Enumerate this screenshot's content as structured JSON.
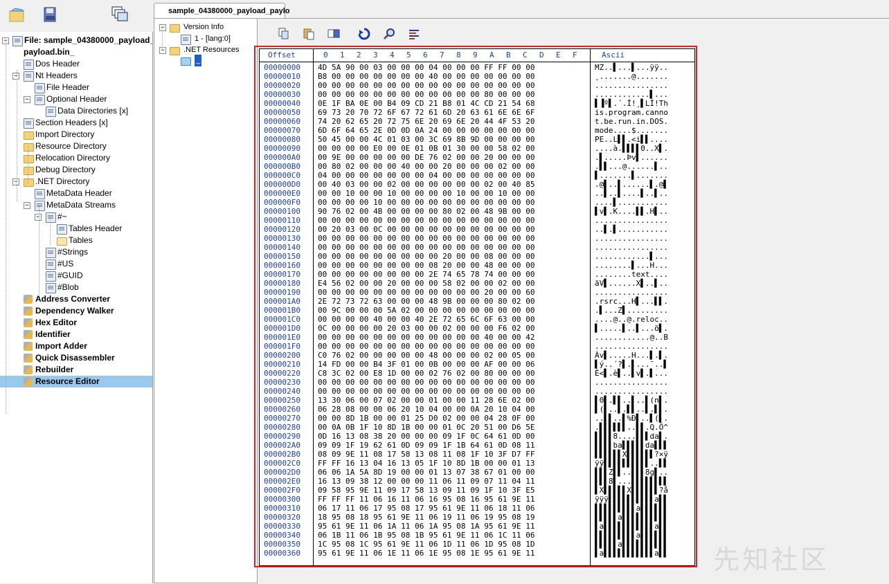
{
  "document_tab": "sample_04380000_payload_paylo",
  "left_tree": [
    {
      "label": "File: sample_04380000_payload_",
      "level": 0,
      "icon": "file-icon",
      "bold": true,
      "pm": "-"
    },
    {
      "label": "payload.bin_",
      "level": 0,
      "icon": "",
      "bold": true,
      "pm": ""
    },
    {
      "label": "Dos Header",
      "level": 1,
      "icon": "doc-icon",
      "bold": false,
      "pm": ""
    },
    {
      "label": "Nt Headers",
      "level": 1,
      "icon": "doc-icon",
      "bold": false,
      "pm": "-"
    },
    {
      "label": "File Header",
      "level": 2,
      "icon": "doc-icon",
      "bold": false,
      "pm": ""
    },
    {
      "label": "Optional Header",
      "level": 2,
      "icon": "doc-icon",
      "bold": false,
      "pm": "-"
    },
    {
      "label": "Data Directories [x]",
      "level": 3,
      "icon": "doc-icon",
      "bold": false,
      "pm": ""
    },
    {
      "label": "Section Headers [x]",
      "level": 1,
      "icon": "doc-icon",
      "bold": false,
      "pm": ""
    },
    {
      "label": "Import Directory",
      "level": 1,
      "icon": "folder-icon",
      "bold": false,
      "pm": ""
    },
    {
      "label": "Resource Directory",
      "level": 1,
      "icon": "folder-icon",
      "bold": false,
      "pm": ""
    },
    {
      "label": "Relocation Directory",
      "level": 1,
      "icon": "folder-icon",
      "bold": false,
      "pm": ""
    },
    {
      "label": "Debug Directory",
      "level": 1,
      "icon": "folder-icon",
      "bold": false,
      "pm": ""
    },
    {
      "label": ".NET Directory",
      "level": 1,
      "icon": "folder-icon",
      "bold": false,
      "pm": "-"
    },
    {
      "label": "MetaData Header",
      "level": 2,
      "icon": "doc-icon",
      "bold": false,
      "pm": ""
    },
    {
      "label": "MetaData Streams",
      "level": 2,
      "icon": "doc-icon",
      "bold": false,
      "pm": "-"
    },
    {
      "label": "#~",
      "level": 3,
      "icon": "doc-icon",
      "bold": false,
      "pm": "-"
    },
    {
      "label": "Tables Header",
      "level": 4,
      "icon": "doc-icon",
      "bold": false,
      "pm": ""
    },
    {
      "label": "Tables",
      "level": 4,
      "icon": "folder-open-icon",
      "bold": false,
      "pm": ""
    },
    {
      "label": "#Strings",
      "level": 3,
      "icon": "doc-icon",
      "bold": false,
      "pm": ""
    },
    {
      "label": "#US",
      "level": 3,
      "icon": "doc-icon",
      "bold": false,
      "pm": ""
    },
    {
      "label": "#GUID",
      "level": 3,
      "icon": "doc-icon",
      "bold": false,
      "pm": ""
    },
    {
      "label": "#Blob",
      "level": 3,
      "icon": "doc-icon",
      "bold": false,
      "pm": ""
    },
    {
      "label": "Address Converter",
      "level": 1,
      "icon": "tool-icon",
      "bold": true,
      "pm": ""
    },
    {
      "label": "Dependency Walker",
      "level": 1,
      "icon": "tool-icon",
      "bold": true,
      "pm": ""
    },
    {
      "label": "Hex Editor",
      "level": 1,
      "icon": "tool-icon",
      "bold": true,
      "pm": ""
    },
    {
      "label": "Identifier",
      "level": 1,
      "icon": "tool-icon",
      "bold": true,
      "pm": ""
    },
    {
      "label": "Import Adder",
      "level": 1,
      "icon": "tool-icon",
      "bold": true,
      "pm": ""
    },
    {
      "label": "Quick Disassembler",
      "level": 1,
      "icon": "tool-icon",
      "bold": true,
      "pm": ""
    },
    {
      "label": "Rebuilder",
      "level": 1,
      "icon": "tool-icon",
      "bold": true,
      "pm": ""
    },
    {
      "label": "Resource Editor",
      "level": 1,
      "icon": "tool-icon",
      "bold": true,
      "pm": "",
      "selected": true
    }
  ],
  "resource_tree": [
    {
      "label": "Version Info",
      "level": 0,
      "pm": "-",
      "icon": "folder-icon"
    },
    {
      "label": "1 - [lang:0]",
      "level": 1,
      "pm": "",
      "icon": "resource-icon"
    },
    {
      "label": ".NET Resources",
      "level": 0,
      "pm": "-",
      "icon": "folder-icon"
    },
    {
      "label": "_",
      "level": 1,
      "pm": "",
      "icon": "folder-open-icon",
      "selected": true
    }
  ],
  "hex_view": {
    "header": {
      "offset": "Offset",
      "columns": [
        "0",
        "1",
        "2",
        "3",
        "4",
        "5",
        "6",
        "7",
        "8",
        "9",
        "A",
        "B",
        "C",
        "D",
        "E",
        "F"
      ],
      "ascii": "Ascii"
    },
    "rows": [
      [
        "00000000",
        "4D 5A 90 00 03 00 00 00 04 00 00 00 FF FF 00 00",
        "MZ..▌...▌...ÿÿ.."
      ],
      [
        "00000010",
        "B8 00 00 00 00 00 00 00 40 00 00 00 00 00 00 00",
        "¸.......@......."
      ],
      [
        "00000020",
        "00 00 00 00 00 00 00 00 00 00 00 00 00 00 00 00",
        "................"
      ],
      [
        "00000030",
        "00 00 00 00 00 00 00 00 00 00 00 00 80 00 00 00",
        "............▌..."
      ],
      [
        "00000040",
        "0E 1F BA 0E 00 B4 09 CD 21 B8 01 4C CD 21 54 68",
        "▌▐º▌.´.Í!¸▌LÍ!Th"
      ],
      [
        "00000050",
        "69 73 20 70 72 6F 67 72 61 6D 20 63 61 6E 6E 6F",
        "is.program.canno"
      ],
      [
        "00000060",
        "74 20 62 65 20 72 75 6E 20 69 6E 20 44 4F 53 20",
        "t.be.run.in.DOS."
      ],
      [
        "00000070",
        "6D 6F 64 65 2E 0D 0D 0A 24 00 00 00 00 00 00 00",
        "mode....$......."
      ],
      [
        "00000080",
        "50 45 00 00 4C 01 03 00 3C 69 8B 9D 00 00 00 00",
        "PE..L▌▌.<i▌▌...."
      ],
      [
        "00000090",
        "00 00 00 00 E0 00 0E 01 0B 01 30 00 00 58 02 00",
        "....à.▌▌▌▌0..X▌."
      ],
      [
        "000000A0",
        "00 9E 00 00 00 00 00 DE 76 02 00 00 20 00 00 00",
        ".▌.....Þv▌......"
      ],
      [
        "000000B0",
        "00 80 02 00 00 00 40 00 00 20 00 00 00 02 00 00",
        ".▌▌...@......▌.."
      ],
      [
        "000000C0",
        "04 00 00 00 00 00 00 00 04 00 00 00 00 00 00 00",
        "▌.......▌......."
      ],
      [
        "000000D0",
        "00 40 03 00 00 02 00 00 00 00 00 00 02 00 40 85",
        ".@▌..▌......▌.@▌"
      ],
      [
        "000000E0",
        "00 00 10 00 00 10 00 00 00 00 10 00 00 10 00 00",
        "..▌..▌....▌..▌.."
      ],
      [
        "000000F0",
        "00 00 00 00 10 00 00 00 00 00 00 00 00 00 00 00",
        "....▌..........."
      ],
      [
        "00000100",
        "90 76 02 00 4B 00 00 00 00 80 02 00 48 9B 00 00",
        "▌v▌.K....▌▌.H▌.."
      ],
      [
        "00000110",
        "00 00 00 00 00 00 00 00 00 00 00 00 00 00 00 00",
        "................"
      ],
      [
        "00000120",
        "00 20 03 00 0C 00 00 00 00 00 00 00 00 00 00 00",
        "..▌.▌..........."
      ],
      [
        "00000130",
        "00 00 00 00 00 00 00 00 00 00 00 00 00 00 00 00",
        "................"
      ],
      [
        "00000140",
        "00 00 00 00 00 00 00 00 00 00 00 00 00 00 00 00",
        "................"
      ],
      [
        "00000150",
        "00 00 00 00 00 00 00 00 00 20 00 00 08 00 00 00",
        "............▌..."
      ],
      [
        "00000160",
        "00 00 00 00 00 00 00 00 08 20 00 00 48 00 00 00",
        "........▌...H..."
      ],
      [
        "00000170",
        "00 00 00 00 00 00 00 00 2E 74 65 78 74 00 00 00",
        "........text...."
      ],
      [
        "00000180",
        "E4 56 02 00 00 20 00 00 00 58 02 00 00 02 00 00",
        "äV▌......X▌..▌.."
      ],
      [
        "00000190",
        "00 00 00 00 00 00 00 00 00 00 00 00 20 00 00 60",
        "................"
      ],
      [
        "000001A0",
        "2E 72 73 72 63 00 00 00 48 9B 00 00 00 80 02 00",
        ".rsrc...H▌...▌▌."
      ],
      [
        "000001B0",
        "00 9C 00 00 00 5A 02 00 00 00 00 00 00 00 00 00",
        ".▌...Z▌........."
      ],
      [
        "000001C0",
        "00 00 00 00 40 00 00 40 2E 72 65 6C 6F 63 00 00",
        "....@..@.reloc.."
      ],
      [
        "000001D0",
        "0C 00 00 00 00 20 03 00 00 02 00 00 00 F6 02 00",
        "▌.....▌..▌...ö▌."
      ],
      [
        "000001E0",
        "00 00 00 00 00 00 00 00 00 00 00 00 40 00 00 42",
        "............@..B"
      ],
      [
        "000001F0",
        "00 00 00 00 00 00 00 00 00 00 00 00 00 00 00 00",
        "................"
      ],
      [
        "00000200",
        "C0 76 02 00 00 00 00 00 48 00 00 00 02 00 05 00",
        "Àv▌.....H...▌.▌."
      ],
      [
        "00000210",
        "14 FD 00 00 B4 3F 01 00 0B 00 00 00 AF 00 00 06",
        "▌ý..´?▌.▌...¯..▌"
      ],
      [
        "00000220",
        "C8 3C 02 00 E8 1D 00 00 02 76 02 00 80 00 00 00",
        "È<▌.è▌..▌v▌.▌..."
      ],
      [
        "00000230",
        "00 00 00 00 00 00 00 00 00 00 00 00 00 00 00 00",
        "................"
      ],
      [
        "00000240",
        "00 00 00 00 00 00 00 00 00 00 00 00 00 00 00 00",
        "................"
      ],
      [
        "00000250",
        "13 30 06 00 07 02 00 00 01 00 00 11 28 6E 02 00",
        "▌0▌.▌▌..▌..▌(n▌."
      ],
      [
        "00000260",
        "06 28 08 00 00 06 20 10 04 00 00 0A 20 10 04 00",
        "▌(▌..▌.▌▌..▌.▌▌."
      ],
      [
        "00000270",
        "00 00 8D 1B 00 00 01 25 D0 02 00 00 04 28 0F 00",
        "..▌▌..▌%Ð▌..▌(▌."
      ],
      [
        "00000280",
        "00 0A 0B 1F 10 8D 1B 00 00 01 0C 20 51 00 D6 5E",
        ".▌▌▌▌▌▌..▌▌.Q.Ö^"
      ],
      [
        "00000290",
        "0D 16 13 08 38 20 00 00 00 09 1F 0C 64 61 0D 00",
        "▌▌▌▌8....▌▌▌da▌."
      ],
      [
        "000002A0",
        "09 09 1F 19 62 61 0D 09 09 1F 1B 64 61 0D 08 11",
        "▌▌▌▌ba▌▌▌▌▌da▌▌▌"
      ],
      [
        "000002B0",
        "08 09 9E 11 08 17 58 13 08 11 08 1F 10 3F D7 FF",
        "▌▌▌▌▌▌X▌▌▌▌▌▌?×ÿ"
      ],
      [
        "000002C0",
        "FF FF 16 13 04 16 13 05 1F 10 8D 1B 00 00 01 13",
        "ÿÿ▌▌▌▌▌▌▌▌▌▌..▌▌"
      ],
      [
        "000002D0",
        "06 06 1A 5A 8D 19 00 00 01 13 07 38 67 01 00 00",
        "▌▌▌Z▌▌..▌▌▌8g▌.."
      ],
      [
        "000002E0",
        "16 13 09 38 12 00 00 00 11 06 11 09 07 11 04 11",
        "▌▌▌8▌...▌▌▌▌▌▌▌▌"
      ],
      [
        "000002F0",
        "09 58 95 9E 11 09 17 58 13 09 11 09 1F 10 3F E5",
        "▌X▌▌▌▌▌X▌▌▌▌▌▌?å"
      ],
      [
        "00000300",
        "FF FF FF 11 06 16 11 06 16 95 08 16 95 61 9E 11",
        "ÿÿÿ▌▌▌▌▌▌▌▌▌▌a▌▌"
      ],
      [
        "00000310",
        "06 17 11 06 17 95 08 17 95 61 9E 11 06 18 11 06",
        "▌▌▌▌▌▌▌▌▌a▌▌▌▌▌▌"
      ],
      [
        "00000320",
        "18 95 08 18 95 61 9E 11 06 19 11 06 19 95 08 19",
        "▌▌▌▌▌a▌▌▌▌▌▌▌▌▌▌"
      ],
      [
        "00000330",
        "95 61 9E 11 06 1A 11 06 1A 95 08 1A 95 61 9E 11",
        "▌a▌▌▌▌▌▌▌▌▌▌▌a▌▌"
      ],
      [
        "00000340",
        "06 1B 11 06 1B 95 08 1B 95 61 9E 11 06 1C 11 06",
        "▌▌▌▌▌▌▌▌▌a▌▌▌▌▌▌"
      ],
      [
        "00000350",
        "1C 95 08 1C 95 61 9E 11 06 1D 11 06 1D 95 08 1D",
        "▌▌▌▌▌a▌▌▌▌▌▌▌▌▌▌"
      ],
      [
        "00000360",
        "95 61 9E 11 06 1E 11 06 1E 95 08 1E 95 61 9E 11",
        "▌a▌▌▌▌▌▌▌▌▌▌▌a▌▌"
      ]
    ]
  },
  "watermark": "先知社区",
  "colors": {
    "offset_blue": "#1c3fa8",
    "selection": "#99c9ef",
    "highlight_frame": "#e02020"
  }
}
